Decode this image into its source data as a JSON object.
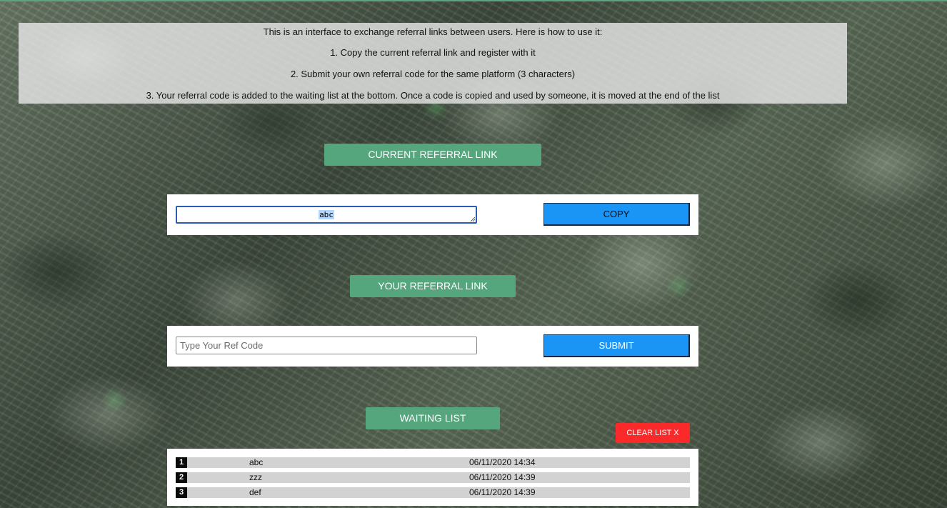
{
  "instructions": {
    "intro": "This is an interface to exchange referral links between users. Here is how to use it:",
    "step1": "1. Copy the current referral link and register with it",
    "step2": "2. Submit your own referral code for the same platform (3 characters)",
    "step3": "3. Your referral code is added to the waiting list at the bottom. Once a code is copied and used by someone, it is moved at the end of the list"
  },
  "current_referral": {
    "header": "CURRENT REFERRAL LINK",
    "value": "abc",
    "copy_label": "COPY"
  },
  "your_referral": {
    "header": "YOUR REFERRAL LINK",
    "placeholder": "Type Your Ref Code",
    "submit_label": "SUBMIT"
  },
  "waiting_list": {
    "header": "WAITING LIST",
    "clear_label": "CLEAR LIST X",
    "rows": [
      {
        "num": "1",
        "code": "abc",
        "time": "06/11/2020 14:34"
      },
      {
        "num": "2",
        "code": "zzz",
        "time": "06/11/2020 14:39"
      },
      {
        "num": "3",
        "code": "def",
        "time": "06/11/2020 14:39"
      }
    ]
  },
  "colors": {
    "header_green": "#55a57d",
    "button_blue": "#1b95f5",
    "clear_red": "#fb2a2a"
  }
}
